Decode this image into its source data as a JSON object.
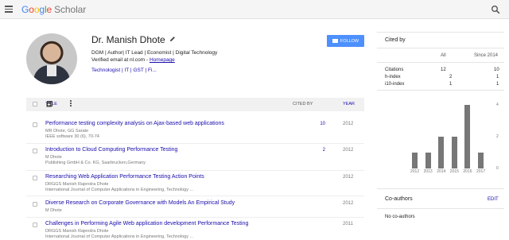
{
  "topbar": {
    "logo_letters": [
      "G",
      "o",
      "o",
      "g",
      "l",
      "e"
    ],
    "logo_product": "Scholar"
  },
  "profile": {
    "name": "Dr. Manish Dhote",
    "affiliation": "DGM | Author| IT Lead | Economist | Digital Technology",
    "email_text": "Verified email at nl.com - ",
    "homepage_label": "Homepage",
    "interests": [
      "Technologist",
      "IT",
      "GST",
      "Fi..."
    ],
    "follow_label": "FOLLOW"
  },
  "table": {
    "col_title": "TITLE",
    "col_cited": "CITED BY",
    "col_year": "YEAR",
    "rows": [
      {
        "title": "Performance testing complexity analysis on Ajax-based web applications",
        "authors": "MR Dhote, GG Sarate",
        "venue": "IEEE software 30 (6), 70-74",
        "cited": "10",
        "year": "2012"
      },
      {
        "title": "Introduction to Cloud Computing Performance Testing",
        "authors": "M Dhote",
        "venue": "Publishing GmbH & Co. KG, Saarbrucken,Germany",
        "cited": "2",
        "year": "2012"
      },
      {
        "title": "Researching Web Application Performance Testing Action Points",
        "authors": "DRGGS Manish Rajendra Dhote",
        "venue": "International Journal of Computer Applications in Engineering, Technology ...",
        "cited": "",
        "year": "2012"
      },
      {
        "title": "Diverse Research on Corporate Governance with Models An Empirical Study",
        "authors": "M Dhote",
        "venue": "",
        "cited": "",
        "year": "2012"
      },
      {
        "title": "Challenges in Performing Agile Web application development Performance Testing",
        "authors": "DRGGS Manish Rajendra Dhote",
        "venue": "International Journal of Computer Applications in Engineering, Technology ...",
        "cited": "",
        "year": "2011"
      }
    ]
  },
  "cited_by": {
    "title": "Cited by",
    "col_all": "All",
    "col_since": "Since 2014",
    "stats": [
      {
        "label": "Citations",
        "all": "12",
        "since": "10"
      },
      {
        "label": "h-index",
        "all": "2",
        "since": "1"
      },
      {
        "label": "i10-index",
        "all": "1",
        "since": "1"
      }
    ]
  },
  "chart_data": {
    "type": "bar",
    "categories": [
      "2012",
      "2013",
      "2014",
      "2015",
      "2016",
      "2017"
    ],
    "values": [
      1,
      1,
      2,
      2,
      4,
      1
    ],
    "ylim": [
      0,
      4
    ],
    "yticks": [
      "4",
      "2",
      "0"
    ]
  },
  "coauthors": {
    "title": "Co-authors",
    "edit_label": "EDIT",
    "empty_text": "No co-authors"
  },
  "colors": {
    "link": "#1a0dab",
    "follow_button": "#4d90fe",
    "bar": "#777777"
  }
}
